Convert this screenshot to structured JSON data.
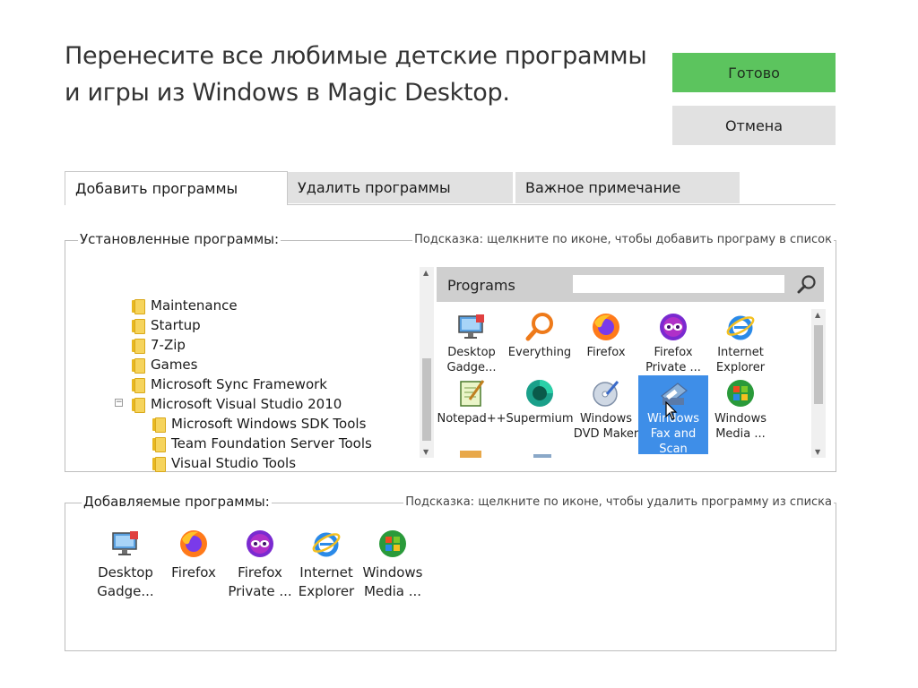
{
  "header": {
    "title": "Перенесите все любимые детские программы и игры из Windows в Magic Desktop.",
    "ok_label": "Готово",
    "cancel_label": "Отмена"
  },
  "tabs": [
    {
      "label": "Добавить программы",
      "active": true
    },
    {
      "label": "Удалить программы",
      "active": false
    },
    {
      "label": "Важное примечание",
      "active": false
    }
  ],
  "installed": {
    "legend": "Установленные программы:",
    "hint": "Подсказка: щелкните по иконе, чтобы добавить програму в список",
    "tree": [
      {
        "label": "Maintenance",
        "level": 0
      },
      {
        "label": "Startup",
        "level": 0
      },
      {
        "label": "7-Zip",
        "level": 0
      },
      {
        "label": "Games",
        "level": 0
      },
      {
        "label": "Microsoft Sync Framework",
        "level": 0
      },
      {
        "label": "Microsoft Visual Studio 2010",
        "level": 0,
        "expanded": true
      },
      {
        "label": "Microsoft Windows SDK Tools",
        "level": 1
      },
      {
        "label": "Team Foundation Server Tools",
        "level": 1
      },
      {
        "label": "Visual Studio Tools",
        "level": 1
      }
    ],
    "programs_header": "Programs",
    "search_placeholder": "",
    "programs": [
      {
        "label": "Desktop Gadge...",
        "icon": "desktop-gadgets-icon"
      },
      {
        "label": "Everything",
        "icon": "everything-icon"
      },
      {
        "label": "Firefox",
        "icon": "firefox-icon"
      },
      {
        "label": "Firefox Private ...",
        "icon": "firefox-private-icon"
      },
      {
        "label": "Internet Explorer",
        "icon": "internet-explorer-icon"
      },
      {
        "label": "Notepad++",
        "icon": "notepad-plus-plus-icon"
      },
      {
        "label": "Supermium",
        "icon": "supermium-icon"
      },
      {
        "label": "Windows DVD Maker",
        "icon": "dvd-maker-icon"
      },
      {
        "label": "Windows Fax and Scan",
        "icon": "fax-scan-icon",
        "selected": true
      },
      {
        "label": "Windows Media ...",
        "icon": "windows-media-icon"
      }
    ]
  },
  "added_programs": {
    "legend": "Добавляемые программы:",
    "hint": "Подсказка: щелкните по иконе, чтобы удалить программу из списка",
    "items": [
      {
        "label": "Desktop Gadge...",
        "icon": "desktop-gadgets-icon"
      },
      {
        "label": "Firefox",
        "icon": "firefox-icon"
      },
      {
        "label": "Firefox Private ...",
        "icon": "firefox-private-icon"
      },
      {
        "label": "Internet Explorer",
        "icon": "internet-explorer-icon"
      },
      {
        "label": "Windows Media ...",
        "icon": "windows-media-icon"
      }
    ]
  }
}
